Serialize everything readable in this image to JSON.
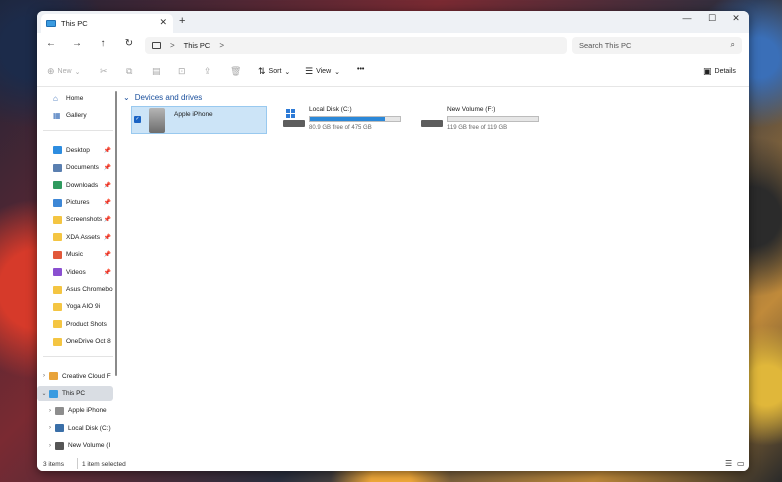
{
  "titlebar": {
    "tab_title": "This PC",
    "tab_close": "✕",
    "new_tab": "+",
    "minimize": "—",
    "maximize": "☐",
    "close": "✕"
  },
  "nav": {
    "back": "←",
    "forward": "→",
    "up": "↑",
    "refresh": "↻",
    "separator": ">",
    "breadcrumb": "This PC",
    "search_placeholder": "Search This PC"
  },
  "toolbar": {
    "new_label": "New",
    "sort_label": "Sort",
    "view_label": "View",
    "more_label": "•••",
    "details_label": "Details"
  },
  "sidebar": {
    "quick": [
      {
        "label": "Home",
        "icon": "home-icon"
      },
      {
        "label": "Gallery",
        "icon": "gallery-icon"
      }
    ],
    "pinned": [
      {
        "label": "Desktop",
        "icon": "desktop-icon",
        "color": "#2d8de0",
        "pinned": true
      },
      {
        "label": "Documents",
        "icon": "documents-icon",
        "color": "#5a7fb0",
        "pinned": true
      },
      {
        "label": "Downloads",
        "icon": "downloads-icon",
        "color": "#2f9a5e",
        "pinned": true
      },
      {
        "label": "Pictures",
        "icon": "pictures-icon",
        "color": "#3d87d6",
        "pinned": true
      },
      {
        "label": "Screenshots",
        "icon": "folder-icon",
        "color": "#f4c542",
        "pinned": true
      },
      {
        "label": "XDA Assets",
        "icon": "folder-icon",
        "color": "#f4c542",
        "pinned": true
      },
      {
        "label": "Music",
        "icon": "music-icon",
        "color": "#e2583a",
        "pinned": true
      },
      {
        "label": "Videos",
        "icon": "videos-icon",
        "color": "#8a4fd0",
        "pinned": true
      },
      {
        "label": "Asus Chromebo",
        "icon": "folder-icon",
        "color": "#f4c542",
        "pinned": false
      },
      {
        "label": "Yoga AIO 9i",
        "icon": "folder-icon",
        "color": "#f4c542",
        "pinned": false
      },
      {
        "label": "Product Shots",
        "icon": "folder-icon",
        "color": "#f4c542",
        "pinned": false
      },
      {
        "label": "OneDrive Oct 8",
        "icon": "folder-icon",
        "color": "#f4c542",
        "pinned": false
      }
    ],
    "tree": [
      {
        "label": "Creative Cloud F",
        "icon": "creative-cloud-icon",
        "color": "#e8a33a",
        "expanded": false,
        "indent": 0,
        "selected": false
      },
      {
        "label": "This PC",
        "icon": "this-pc-icon",
        "color": "#3a9be0",
        "expanded": true,
        "indent": 0,
        "selected": true
      },
      {
        "label": "Apple iPhone",
        "icon": "iphone-icon",
        "color": "#8d8d8d",
        "expanded": false,
        "indent": 1,
        "selected": false
      },
      {
        "label": "Local Disk (C:)",
        "icon": "local-disk-icon",
        "color": "#3a6fa8",
        "expanded": false,
        "indent": 1,
        "selected": false
      },
      {
        "label": "New Volume (I",
        "icon": "drive-icon",
        "color": "#555555",
        "expanded": false,
        "indent": 1,
        "selected": false
      }
    ]
  },
  "content": {
    "group_label": "Devices and drives",
    "devices": [
      {
        "name": "Apple iPhone",
        "icon": "iphone-icon",
        "selected": true
      },
      {
        "name": "Local Disk (C:)",
        "icon": "windows-drive-icon",
        "free_text": "80.9 GB free of 475 GB",
        "used_fraction": 0.83
      },
      {
        "name": "New Volume (F:)",
        "icon": "drive-icon",
        "free_text": "119 GB free of 119 GB",
        "used_fraction": 0.0
      }
    ]
  },
  "status": {
    "items": "3 items",
    "selected": "1 item selected"
  }
}
